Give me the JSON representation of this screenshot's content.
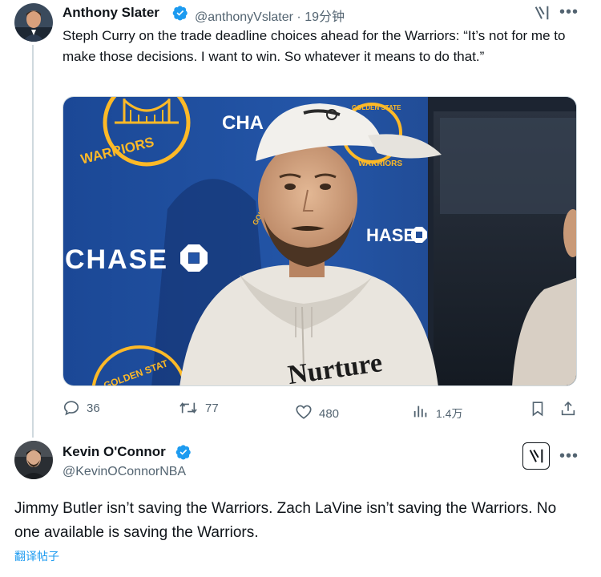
{
  "tweet1": {
    "author_name": "Anthony Slater",
    "handle_time": "@anthonyVslater · 19分钟",
    "text": "Steph Curry on the trade deadline choices ahead for the Warriors: “It’s not for me to make those decisions. I want to win. So whatever it means to do that.”",
    "media": {
      "logo_text_top": "WARRIORS",
      "sponsor": "CHASE",
      "sponsor_short": "CHA",
      "sponsor_right": "HASE",
      "logo_text_ring": "GOLDEN STATE",
      "logo_text_ring_2": "WARRIORS",
      "logo_text_bottom": "GOLDEN STAT",
      "logo_text_gold": "GOL",
      "hoodie_text": "Nurture"
    },
    "stats": {
      "replies": "36",
      "reposts": "77",
      "likes": "480",
      "views": "1.4万"
    }
  },
  "tweet2": {
    "author_name": "Kevin O'Connor",
    "handle": "@KevinOConnorNBA",
    "text": "Jimmy Butler isn’t saving the Warriors. Zach LaVine isn’t saving the Warriors. No one available is saving the Warriors.",
    "translate_label": "翻译帖子"
  },
  "icons": {
    "grok": "grok-icon",
    "more": "more-icon",
    "reply": "reply-icon",
    "repost": "repost-icon",
    "like": "heart-icon",
    "views": "views-icon",
    "bookmark": "bookmark-icon",
    "share": "share-icon",
    "verified": "verified-badge-icon"
  },
  "colors": {
    "verified": "#1d9bf0",
    "secondary_text": "#536471",
    "link": "#1d9bf0",
    "backdrop_blue": "#1f4fa0",
    "warriors_gold": "#fdb927"
  }
}
